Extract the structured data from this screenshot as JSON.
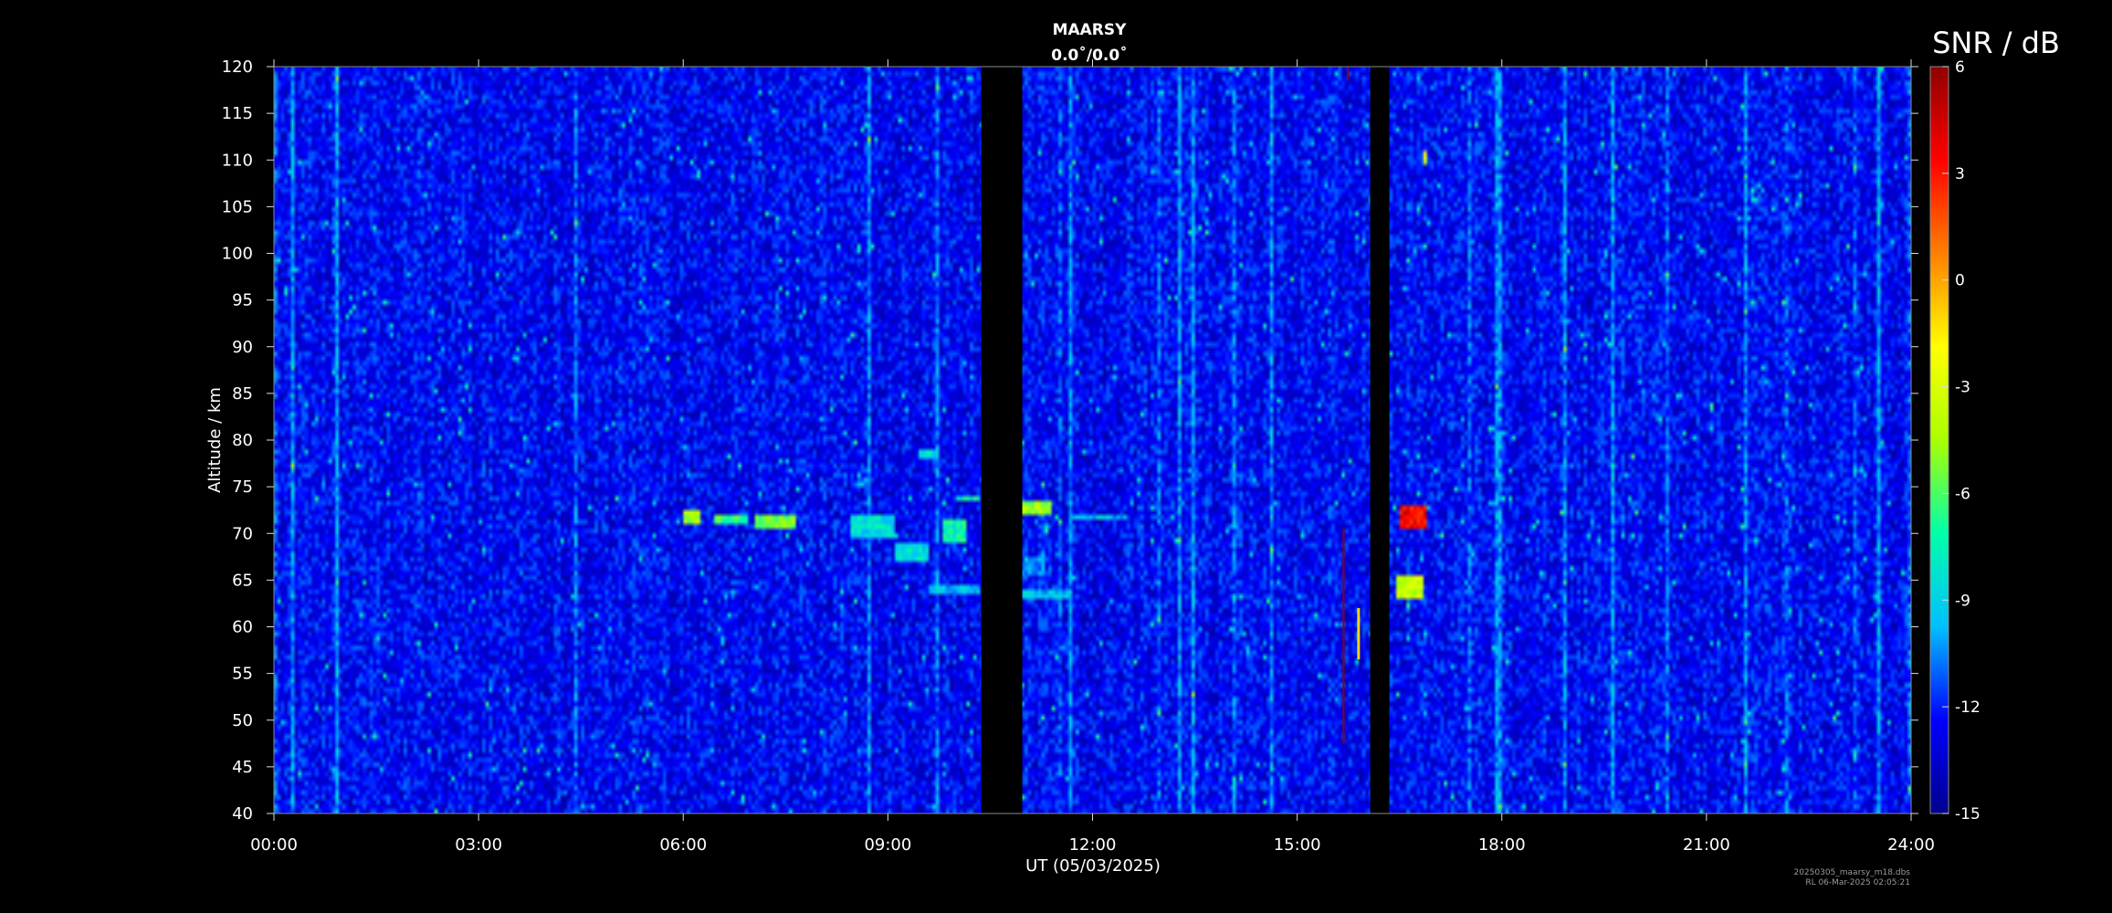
{
  "chart_data": {
    "type": "heatmap",
    "title": "MAARSY",
    "subtitle": "0.0˚/0.0˚",
    "xlabel": "UT (05/03/2025)",
    "ylabel": "Altitude / km",
    "colorbar_label": "SNR / dB",
    "x_unit": "hours UT",
    "xlim": [
      0,
      24
    ],
    "ylim": [
      40,
      120
    ],
    "clim": [
      -15,
      6
    ],
    "x_ticks": [
      0,
      3,
      6,
      9,
      12,
      15,
      18,
      21,
      24
    ],
    "x_tick_labels": [
      "00:00",
      "03:00",
      "06:00",
      "09:00",
      "12:00",
      "15:00",
      "18:00",
      "21:00",
      "24:00"
    ],
    "y_ticks": [
      40,
      45,
      50,
      55,
      60,
      65,
      70,
      75,
      80,
      85,
      90,
      95,
      100,
      105,
      110,
      115,
      120
    ],
    "colorbar_ticks": [
      6,
      3,
      0,
      -3,
      -6,
      -9,
      -12,
      -15
    ],
    "colormap": [
      "#00008f",
      "#0000ff",
      "#00bfff",
      "#00ffaa",
      "#aaff00",
      "#ffff00",
      "#ff8000",
      "#ff0000",
      "#8f0000"
    ],
    "background_level_db": -13,
    "data_gaps": [
      [
        10.37,
        10.97
      ],
      [
        16.07,
        16.35
      ]
    ],
    "echo_regions": [
      {
        "x": [
          6.0,
          6.25
        ],
        "y": [
          71,
          72.5
        ],
        "snr": -3
      },
      {
        "x": [
          6.45,
          6.95
        ],
        "y": [
          71.2,
          72.2
        ],
        "snr": -5
      },
      {
        "x": [
          7.05,
          7.65
        ],
        "y": [
          70.5,
          72
        ],
        "snr": -4
      },
      {
        "x": [
          8.45,
          9.1
        ],
        "y": [
          69.5,
          72
        ],
        "snr": -7
      },
      {
        "x": [
          9.1,
          9.6
        ],
        "y": [
          67,
          69
        ],
        "snr": -7
      },
      {
        "x": [
          9.45,
          9.75
        ],
        "y": [
          77.8,
          78.8
        ],
        "snr": -7
      },
      {
        "x": [
          9.8,
          10.15
        ],
        "y": [
          69,
          71.5
        ],
        "snr": -6
      },
      {
        "x": [
          10.0,
          10.37
        ],
        "y": [
          73.5,
          74
        ],
        "snr": -6
      },
      {
        "x": [
          9.6,
          10.37
        ],
        "y": [
          63.5,
          64.5
        ],
        "snr": -8
      },
      {
        "x": [
          10.97,
          11.4
        ],
        "y": [
          72,
          73.5
        ],
        "snr": -3
      },
      {
        "x": [
          11.7,
          12.5
        ],
        "y": [
          71.5,
          72.2
        ],
        "snr": -8
      },
      {
        "x": [
          10.97,
          11.7
        ],
        "y": [
          63,
          64
        ],
        "snr": -8
      },
      {
        "x": [
          10.97,
          11.3
        ],
        "y": [
          65.5,
          67.5
        ],
        "snr": -9
      },
      {
        "x": [
          16.5,
          16.9
        ],
        "y": [
          70.5,
          73
        ],
        "snr": 5
      },
      {
        "x": [
          16.45,
          16.85
        ],
        "y": [
          63,
          65.5
        ],
        "snr": -2
      },
      {
        "x": [
          17.8,
          17.95
        ],
        "y": [
          73,
          73.5
        ],
        "snr": -8
      },
      {
        "x": [
          14.0,
          14.15
        ],
        "y": [
          70.5,
          71
        ],
        "snr": -9
      },
      {
        "x": [
          14.1,
          14.2
        ],
        "y": [
          68.5,
          69
        ],
        "snr": -9
      },
      {
        "x": [
          16.85,
          16.9
        ],
        "y": [
          109.5,
          111
        ],
        "snr": -1
      }
    ],
    "spike_lines": [
      {
        "x": 15.68,
        "y": [
          47.5,
          70.5
        ],
        "snr": 6
      },
      {
        "x": 15.74,
        "y": [
          118.5,
          120
        ],
        "snr": 6
      },
      {
        "x": 15.9,
        "y": [
          56.5,
          62
        ],
        "snr": -1
      }
    ]
  },
  "footer": {
    "file_name": "20250305_maarsy_m18.dbs",
    "created": "RL 06-Mar-2025 02:05:21"
  }
}
